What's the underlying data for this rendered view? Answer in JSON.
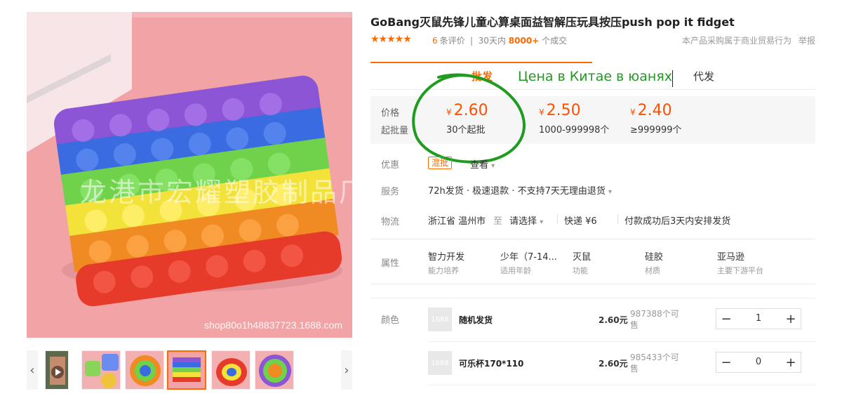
{
  "product": {
    "title": "GoBang灭鼠先锋儿童心算桌面益智解压玩具按压push pop it fidget",
    "stars": "★★★★★",
    "review_count": "6",
    "review_label": "条评价",
    "sales_prefix": "30天内",
    "sales_count": "8000+",
    "sales_suffix": "个成交",
    "notice": "本产品采购属于商业贸易行为",
    "report": "举报"
  },
  "gallery": {
    "watermark": "龙港市宏耀塑胶制品厂",
    "shop_mark": "shop80o1h48837723.1688.com",
    "prev_icon": "‹",
    "next_icon": "›"
  },
  "tabs": {
    "wholesale": "批发",
    "dropship": "代发"
  },
  "annotation": "Цена в Китае в юанях",
  "price_box": {
    "price_label": "价格",
    "moq_label": "起批量",
    "currency": "¥",
    "tiers": [
      {
        "price": "2.60",
        "range": "30个起批"
      },
      {
        "price": "2.50",
        "range": "1000-999998个"
      },
      {
        "price": "2.40",
        "range": "≥999999个"
      }
    ]
  },
  "promo": {
    "label": "优惠",
    "tag": "混批",
    "link": "查看"
  },
  "service": {
    "label": "服务",
    "text": "72h发货 · 极速退款 · 不支持7天无理由退货"
  },
  "logistics": {
    "label": "物流",
    "origin": "浙江省 温州市",
    "to": "至",
    "select": "请选择",
    "shipping": "快递 ¥6",
    "dispatch": "付款成功后3天内安排发货"
  },
  "attributes": {
    "label": "属性",
    "items": [
      {
        "value": "智力开发",
        "key": "能力培养"
      },
      {
        "value": "少年（7-14...",
        "key": "适用年龄"
      },
      {
        "value": "灭鼠",
        "key": "功能"
      },
      {
        "value": "硅胶",
        "key": "材质"
      },
      {
        "value": "亚马逊",
        "key": "主要下游平台"
      }
    ]
  },
  "sku": {
    "label": "颜色",
    "placeholder": "1688",
    "items": [
      {
        "name": "随机发货",
        "price": "2.60元",
        "stock": "987388个可售",
        "qty": "1"
      },
      {
        "name": "可乐杯170*110",
        "price": "2.60元",
        "stock": "985433个可售",
        "qty": "0"
      }
    ],
    "minus": "−",
    "plus": "+"
  },
  "colors": {
    "accent": "#ff6a00",
    "price": "#ff5000",
    "annotation": "#1f9b1f"
  }
}
